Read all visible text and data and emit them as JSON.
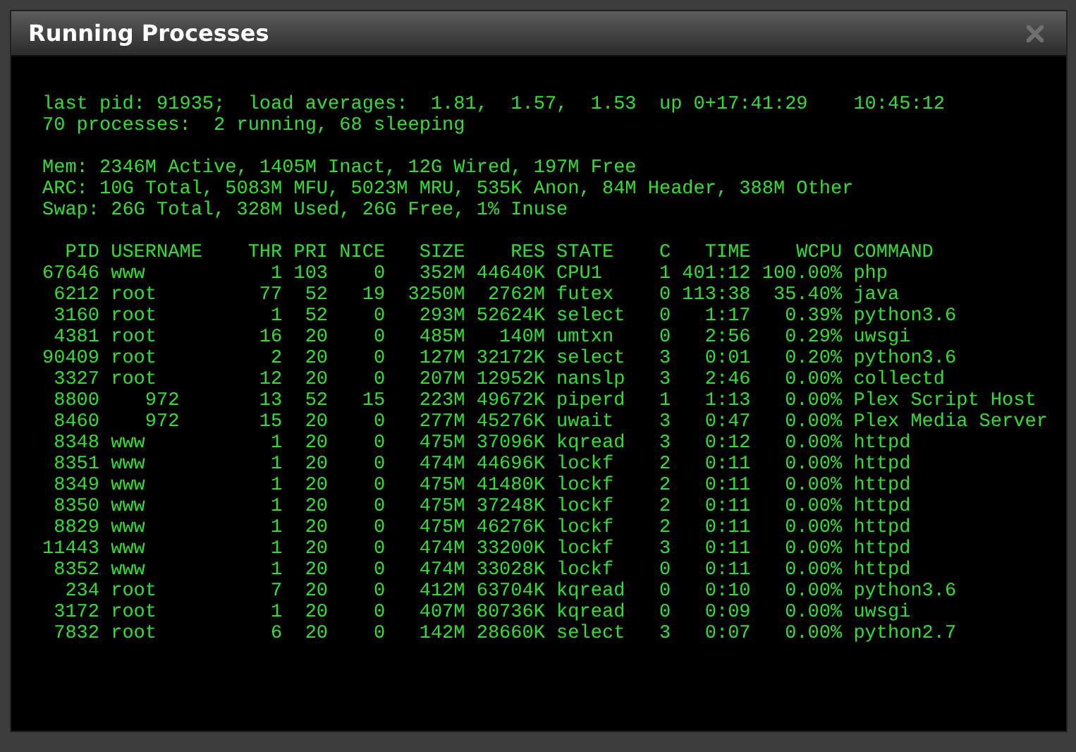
{
  "window": {
    "title": "Running Processes"
  },
  "summary": [
    "last pid: 91935;  load averages:  1.81,  1.57,  1.53  up 0+17:41:29    10:45:12",
    "70 processes:  2 running, 68 sleeping"
  ],
  "memory": [
    "Mem: 2346M Active, 1405M Inact, 12G Wired, 197M Free",
    "ARC: 10G Total, 5083M MFU, 5023M MRU, 535K Anon, 84M Header, 388M Other",
    "Swap: 26G Total, 328M Used, 26G Free, 1% Inuse"
  ],
  "table": {
    "columns": [
      "PID",
      "USERNAME",
      "THR",
      "PRI",
      "NICE",
      "SIZE",
      "RES",
      "STATE",
      "C",
      "TIME",
      "WCPU",
      "COMMAND"
    ],
    "rows": [
      {
        "kind": "name",
        "cells": [
          "67646",
          "www",
          "1",
          "103",
          "0",
          "352M",
          "44640K",
          "CPU1",
          "1",
          "401:12",
          "100.00%",
          "php"
        ]
      },
      {
        "kind": "name",
        "cells": [
          "6212",
          "root",
          "77",
          "52",
          "19",
          "3250M",
          "2762M",
          "futex",
          "0",
          "113:38",
          "35.40%",
          "java"
        ]
      },
      {
        "kind": "name",
        "cells": [
          "3160",
          "root",
          "1",
          "52",
          "0",
          "293M",
          "52624K",
          "select",
          "0",
          "1:17",
          "0.39%",
          "python3.6"
        ]
      },
      {
        "kind": "name",
        "cells": [
          "4381",
          "root",
          "16",
          "20",
          "0",
          "485M",
          "140M",
          "umtxn",
          "0",
          "2:56",
          "0.29%",
          "uwsgi"
        ]
      },
      {
        "kind": "name",
        "cells": [
          "90409",
          "root",
          "2",
          "20",
          "0",
          "127M",
          "32172K",
          "select",
          "3",
          "0:01",
          "0.20%",
          "python3.6"
        ]
      },
      {
        "kind": "name",
        "cells": [
          "3327",
          "root",
          "12",
          "20",
          "0",
          "207M",
          "12952K",
          "nanslp",
          "3",
          "2:46",
          "0.00%",
          "collectd"
        ]
      },
      {
        "kind": "uid",
        "cells": [
          "8800",
          "972",
          "13",
          "52",
          "15",
          "223M",
          "49672K",
          "piperd",
          "1",
          "1:13",
          "0.00%",
          "Plex Script Host"
        ]
      },
      {
        "kind": "uid",
        "cells": [
          "8460",
          "972",
          "15",
          "20",
          "0",
          "277M",
          "45276K",
          "uwait",
          "3",
          "0:47",
          "0.00%",
          "Plex Media Server"
        ]
      },
      {
        "kind": "name",
        "cells": [
          "8348",
          "www",
          "1",
          "20",
          "0",
          "475M",
          "37096K",
          "kqread",
          "3",
          "0:12",
          "0.00%",
          "httpd"
        ]
      },
      {
        "kind": "name",
        "cells": [
          "8351",
          "www",
          "1",
          "20",
          "0",
          "474M",
          "44696K",
          "lockf",
          "2",
          "0:11",
          "0.00%",
          "httpd"
        ]
      },
      {
        "kind": "name",
        "cells": [
          "8349",
          "www",
          "1",
          "20",
          "0",
          "475M",
          "41480K",
          "lockf",
          "2",
          "0:11",
          "0.00%",
          "httpd"
        ]
      },
      {
        "kind": "name",
        "cells": [
          "8350",
          "www",
          "1",
          "20",
          "0",
          "475M",
          "37248K",
          "lockf",
          "2",
          "0:11",
          "0.00%",
          "httpd"
        ]
      },
      {
        "kind": "name",
        "cells": [
          "8829",
          "www",
          "1",
          "20",
          "0",
          "475M",
          "46276K",
          "lockf",
          "2",
          "0:11",
          "0.00%",
          "httpd"
        ]
      },
      {
        "kind": "name",
        "cells": [
          "11443",
          "www",
          "1",
          "20",
          "0",
          "474M",
          "33200K",
          "lockf",
          "3",
          "0:11",
          "0.00%",
          "httpd"
        ]
      },
      {
        "kind": "name",
        "cells": [
          "8352",
          "www",
          "1",
          "20",
          "0",
          "474M",
          "33028K",
          "lockf",
          "0",
          "0:11",
          "0.00%",
          "httpd"
        ]
      },
      {
        "kind": "name",
        "cells": [
          "234",
          "root",
          "7",
          "20",
          "0",
          "412M",
          "63704K",
          "kqread",
          "0",
          "0:10",
          "0.00%",
          "python3.6"
        ]
      },
      {
        "kind": "name",
        "cells": [
          "3172",
          "root",
          "1",
          "20",
          "0",
          "407M",
          "80736K",
          "kqread",
          "0",
          "0:09",
          "0.00%",
          "uwsgi"
        ]
      },
      {
        "kind": "name",
        "cells": [
          "7832",
          "root",
          "6",
          "20",
          "0",
          "142M",
          "28660K",
          "select",
          "3",
          "0:07",
          "0.00%",
          "python2.7"
        ]
      }
    ]
  }
}
